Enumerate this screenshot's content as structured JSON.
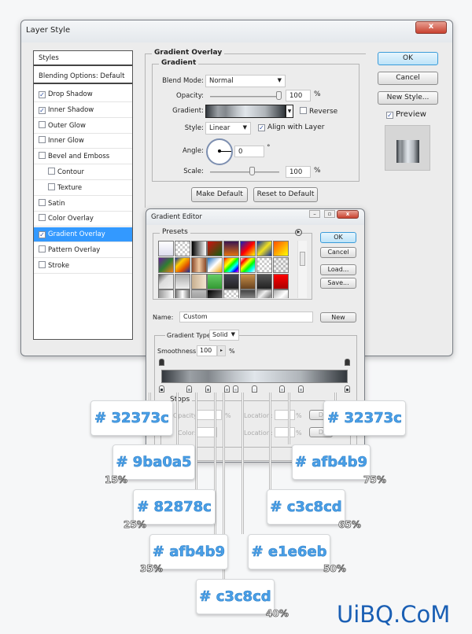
{
  "layer_style": {
    "title": "Layer Style",
    "close": "x",
    "styles_header": "Styles",
    "blending": "Blending Options: Default",
    "items": [
      {
        "label": "Drop Shadow",
        "checked": true
      },
      {
        "label": "Inner Shadow",
        "checked": true
      },
      {
        "label": "Outer Glow",
        "checked": false
      },
      {
        "label": "Inner Glow",
        "checked": false
      },
      {
        "label": "Bevel and Emboss",
        "checked": false
      },
      {
        "label": "Contour",
        "checked": false,
        "indent": true
      },
      {
        "label": "Texture",
        "checked": false,
        "indent": true
      },
      {
        "label": "Satin",
        "checked": false
      },
      {
        "label": "Color Overlay",
        "checked": false
      },
      {
        "label": "Gradient Overlay",
        "checked": true,
        "selected": true
      },
      {
        "label": "Pattern Overlay",
        "checked": false
      },
      {
        "label": "Stroke",
        "checked": false
      }
    ],
    "panel": {
      "title": "Gradient Overlay",
      "sub": "Gradient",
      "blend_label": "Blend Mode:",
      "blend_value": "Normal",
      "opacity_label": "Opacity:",
      "opacity_value": "100",
      "opacity_unit": "%",
      "gradient_label": "Gradient:",
      "reverse_label": "Reverse",
      "style_label": "Style:",
      "style_value": "Linear",
      "align_label": "Align with Layer",
      "angle_label": "Angle:",
      "angle_value": "0",
      "angle_unit": "°",
      "scale_label": "Scale:",
      "scale_value": "100",
      "scale_unit": "%",
      "make_default": "Make Default",
      "reset_default": "Reset to Default"
    },
    "ok": "OK",
    "cancel": "Cancel",
    "new_style": "New Style...",
    "preview": "Preview"
  },
  "gradient_editor": {
    "title": "Gradient Editor",
    "presets": "Presets",
    "ok": "OK",
    "cancel": "Cancel",
    "load": "Load...",
    "save": "Save...",
    "name_label": "Name:",
    "name_value": "Custom",
    "new": "New",
    "type_label": "Gradient Type:",
    "type_value": "Solid",
    "smooth_label": "Smoothness:",
    "smooth_value": "100",
    "smooth_unit": "%",
    "stops": "Stops",
    "opacity": "Opacity:",
    "color": "Color:",
    "location": "Location:",
    "pct": "%",
    "delete": "D"
  },
  "gradient_stops": [
    {
      "loc": 0,
      "color": "#32373c"
    },
    {
      "loc": 15,
      "color": "#9ba0a5"
    },
    {
      "loc": 25,
      "color": "#82878c"
    },
    {
      "loc": 35,
      "color": "#afb4b9"
    },
    {
      "loc": 40,
      "color": "#c3c8cd"
    },
    {
      "loc": 50,
      "color": "#e1e6eb"
    },
    {
      "loc": 65,
      "color": "#c3c8cd"
    },
    {
      "loc": 75,
      "color": "#afb4b9"
    },
    {
      "loc": 100,
      "color": "#32373c"
    }
  ],
  "callouts": [
    {
      "hex": "# 32373c",
      "pct": ""
    },
    {
      "hex": "# 9ba0a5",
      "pct": "15%"
    },
    {
      "hex": "# 82878c",
      "pct": "25%"
    },
    {
      "hex": "# afb4b9",
      "pct": "35%"
    },
    {
      "hex": "# c3c8cd",
      "pct": "40%"
    },
    {
      "hex": "# e1e6eb",
      "pct": "50%"
    },
    {
      "hex": "# c3c8cd",
      "pct": "65%"
    },
    {
      "hex": "# afb4b9",
      "pct": "75%"
    },
    {
      "hex": "# 32373c",
      "pct": ""
    }
  ],
  "watermark": "UiBQ.CoM",
  "colors": {
    "accent": "#3399ff",
    "callout_text": "#4aa0e8",
    "watermark": "#1a5fb4"
  }
}
